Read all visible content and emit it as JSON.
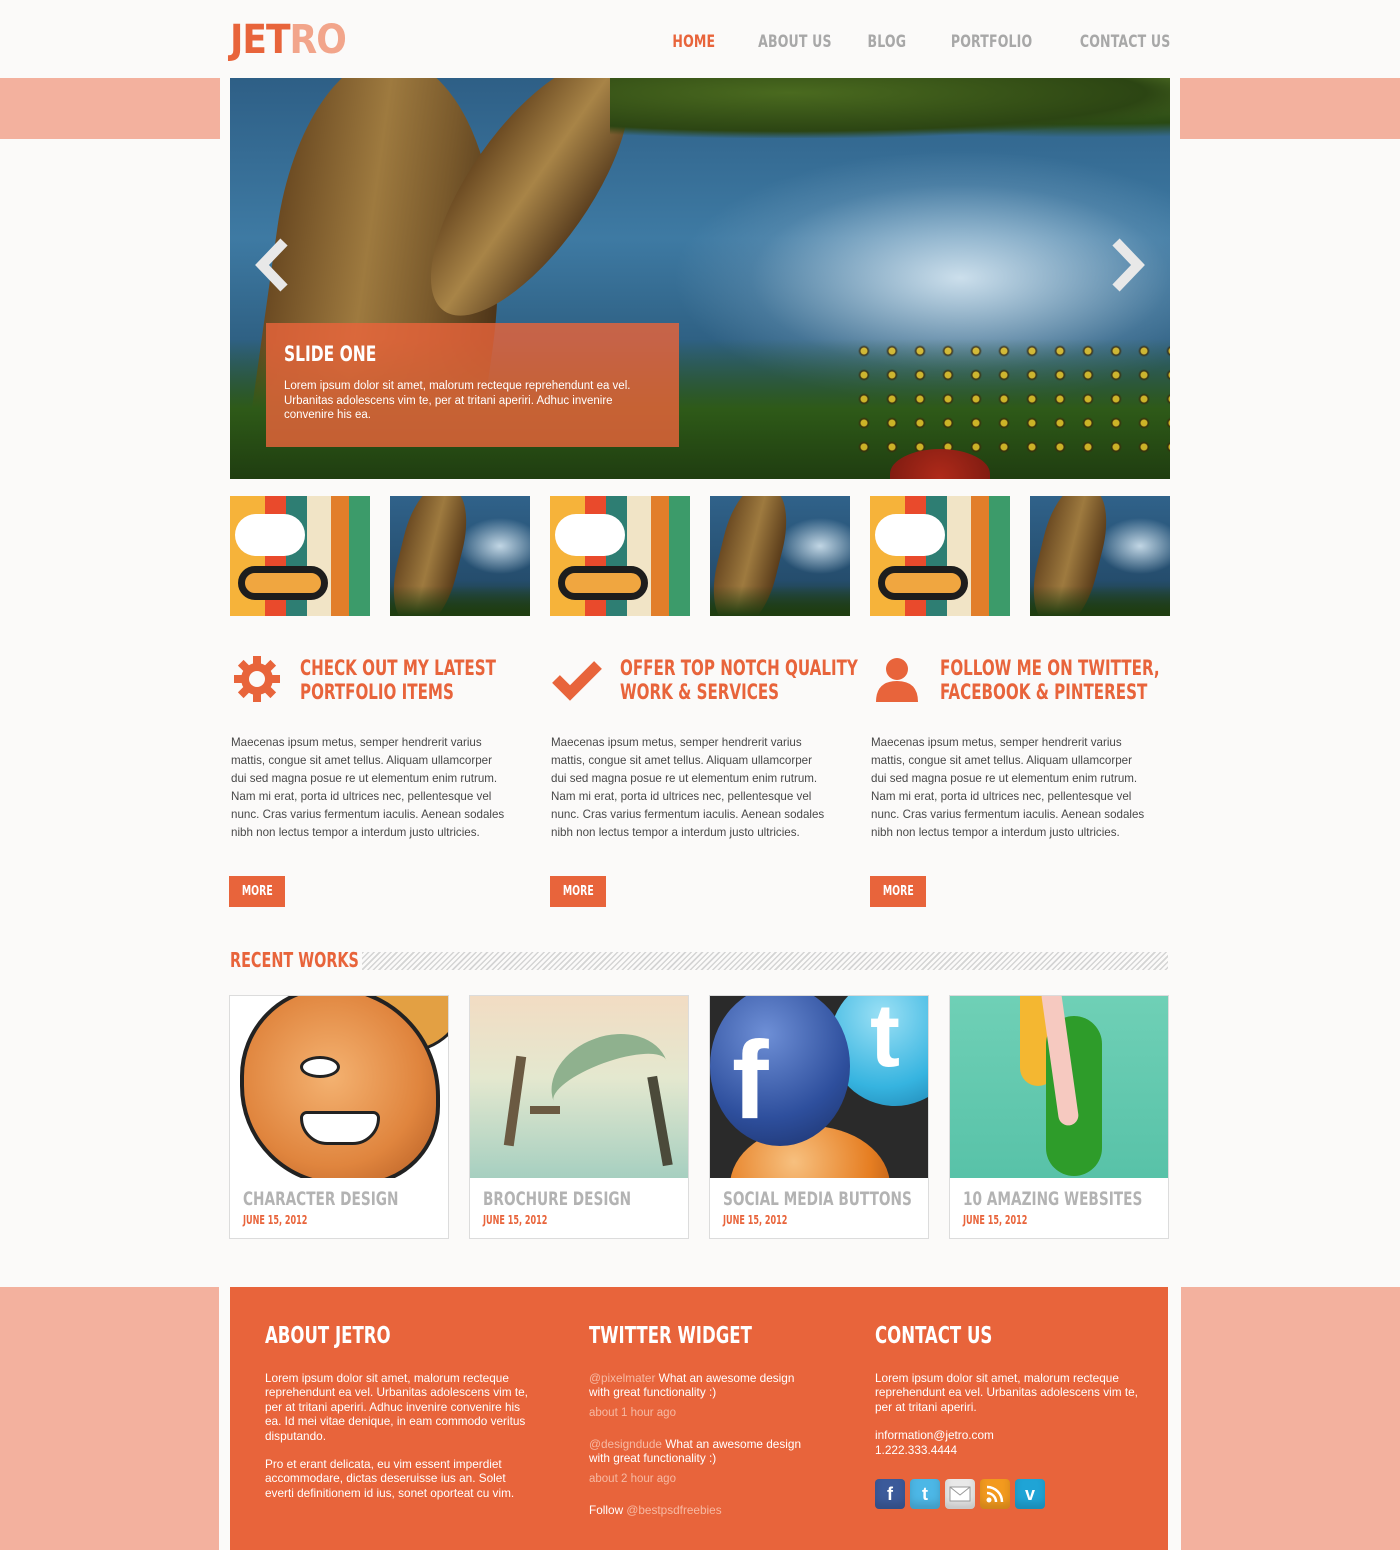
{
  "brand": {
    "logo_part1": "JET",
    "logo_part2": "RO",
    "accent": "#e8643b",
    "accent_light": "#f3b19e"
  },
  "nav": {
    "items": [
      "HOME",
      "ABOUT US",
      "BLOG",
      "PORTFOLIO",
      "CONTACT US"
    ],
    "active": "HOME"
  },
  "slider": {
    "caption_title": "SLIDE ONE",
    "caption_text": "Lorem ipsum dolor sit amet, malorum recteque reprehendunt ea vel. Urbanitas adolescens vim te, per at tritani aperiri. Adhuc invenire convenire his ea.",
    "prev_icon": "chevron-left-icon",
    "next_icon": "chevron-right-icon"
  },
  "features": [
    {
      "icon": "gear-icon",
      "title_line1": "CHECK OUT MY LATEST",
      "title_line2": "PORTFOLIO ITEMS",
      "text": "Maecenas ipsum metus, semper hendrerit varius mattis, congue sit amet tellus. Aliquam ullamcorper dui sed magna posue re ut elementum enim rutrum. Nam mi erat, porta id ultrices nec, pellentesque vel nunc. Cras varius fermentum iaculis. Aenean sodales nibh non lectus tempor a interdum justo ultricies.",
      "button": "MORE"
    },
    {
      "icon": "checkmark-icon",
      "title_line1": "OFFER TOP NOTCH QUALITY",
      "title_line2": "WORK & SERVICES",
      "text": "Maecenas ipsum metus, semper hendrerit varius mattis, congue sit amet tellus. Aliquam ullamcorper dui sed magna posue re ut elementum enim rutrum. Nam mi erat, porta id ultrices nec, pellentesque vel nunc. Cras varius fermentum iaculis. Aenean sodales nibh non lectus tempor a interdum justo ultricies.",
      "button": "MORE"
    },
    {
      "icon": "user-icon",
      "title_line1": "FOLLOW ME ON TWITTER,",
      "title_line2": "FACEBOOK & PINTEREST",
      "text": "Maecenas ipsum metus, semper hendrerit varius mattis, congue sit amet tellus. Aliquam ullamcorper dui sed magna posue re ut elementum enim rutrum. Nam mi erat, porta id ultrices nec, pellentesque vel nunc. Cras varius fermentum iaculis. Aenean sodales nibh non lectus tempor a interdum justo ultricies.",
      "button": "MORE"
    }
  ],
  "recent_works": {
    "heading": "RECENT WORKS",
    "items": [
      {
        "title": "CHARACTER DESIGN",
        "date": "JUNE 15, 2012"
      },
      {
        "title": "BROCHURE DESIGN",
        "date": "JUNE 15, 2012"
      },
      {
        "title": "SOCIAL MEDIA BUTTONS",
        "date": "JUNE 15, 2012"
      },
      {
        "title": "10 AMAZING WEBSITES",
        "date": "JUNE 15, 2012"
      }
    ]
  },
  "footer": {
    "about": {
      "heading": "ABOUT JETRO",
      "p1": "Lorem ipsum dolor sit amet, malorum recteque reprehendunt ea vel. Urbanitas adolescens vim te, per at tritani aperiri. Adhuc invenire convenire his ea. Id mei vitae denique, in eam commodo veritus disputando.",
      "p2": "Pro et erant delicata, eu vim essent imperdiet accommodare, dictas deseruisse ius an. Solet everti definitionem id ius, sonet oporteat cu vim."
    },
    "twitter": {
      "heading": "TWITTER WIDGET",
      "tweets": [
        {
          "handle": "@pixelmater",
          "text": " What an awesome design with great functionality :)",
          "ago": "about 1 hour ago"
        },
        {
          "handle": "@designdude",
          "text": " What an awesome design with great functionality :)",
          "ago": "about 2 hour ago"
        }
      ],
      "follow_label": "Follow ",
      "follow_handle": "@bestpsdfreebies"
    },
    "contact": {
      "heading": "CONTACT US",
      "text": "Lorem ipsum dolor sit amet, malorum recteque reprehendunt ea vel. Urbanitas adolescens vim te, per at tritani aperiri.",
      "email": "information@jetro.com",
      "phone": "1.222.333.4444",
      "socials": [
        "facebook-icon",
        "twitter-icon",
        "mail-icon",
        "rss-icon",
        "vimeo-icon"
      ]
    }
  }
}
